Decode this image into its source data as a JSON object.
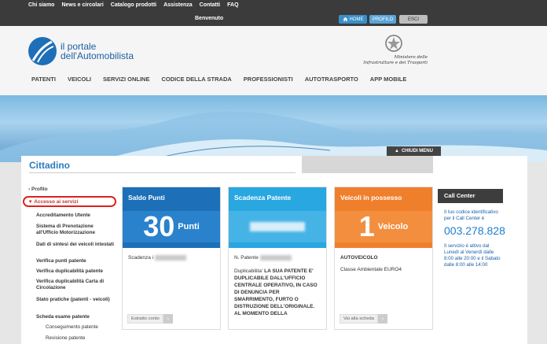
{
  "topbar": {
    "links": [
      "Chi siamo",
      "News e circolari",
      "Catalogo prodotti",
      "Assistenza",
      "Contatti",
      "FAQ"
    ],
    "welcome": "Benvenuto",
    "home": "HOME",
    "profilo": "PROFILO",
    "esci": "ESCI"
  },
  "header": {
    "logo_line1": "il portale",
    "logo_line2": "dell'Automobilista",
    "ministry_line1": "Ministero delle",
    "ministry_line2": "Infrastrutture e dei Trasporti",
    "nav": [
      "PATENTI",
      "VEICOLI",
      "SERVIZI ONLINE",
      "CODICE DELLA STRADA",
      "PROFESSIONISTI",
      "AUTOTRASPORTO",
      "APP MOBILE"
    ]
  },
  "hero": {
    "chiudi": "CHIUDI MENU"
  },
  "panel": {
    "title": "Cittadino"
  },
  "sidebar": {
    "profilo": "Profilo",
    "accesso": "Accesso ai servizi",
    "items": [
      "Accreditamento Utente",
      "Sistema di Prenotazione all'Ufficio Motorizzazione",
      "Dati di sintesi dei veicoli intestati",
      "Verifica punti patente",
      "Verifica duplicabilità patente",
      "Verifica duplicabilità Carta di Circolazione",
      "Stato pratiche (patenti - veicoli)",
      "Scheda esame patente"
    ],
    "subitems": [
      "Conseguimento patente",
      "Revisione patente"
    ]
  },
  "cards": {
    "saldo": {
      "title": "Saldo Punti",
      "value": "30",
      "unit": "Punti",
      "label": "Scadenza i",
      "button": "Estratto conto",
      "color": "#1d6fb8"
    },
    "scadenza": {
      "title": "Scadenza Patente",
      "label": "N. Patente",
      "text_intro": "Duplicabilita'",
      "text": "LA SUA PATENTE E' DUPLICABILE DALL'UFFICIO CENTRALE OPERATIVO, IN CASO DI DENUNCIA PER SMARRIMENTO, FURTO O DISTRUZIONE DELL'ORIGINALE. AL MOMENTO DELLA",
      "color": "#29a7e1"
    },
    "veicoli": {
      "title": "Veicoli in possesso",
      "value": "1",
      "unit": "Veicolo",
      "line1": "AUTOVEICOLO",
      "line2": "Classe Ambientale EURO4",
      "button": "Vai alla scheda",
      "color": "#f07f2c"
    }
  },
  "callcenter": {
    "title": "Call Center",
    "intro": "Il tuo codice identificativo per il Call Center è",
    "number": "003.278.828",
    "hours": "Il servizio è attivo dal Lunedì al Venerdì dalle 8:00 alle 20:00 e il Sabato dalle 8:00 alle 14:00"
  }
}
